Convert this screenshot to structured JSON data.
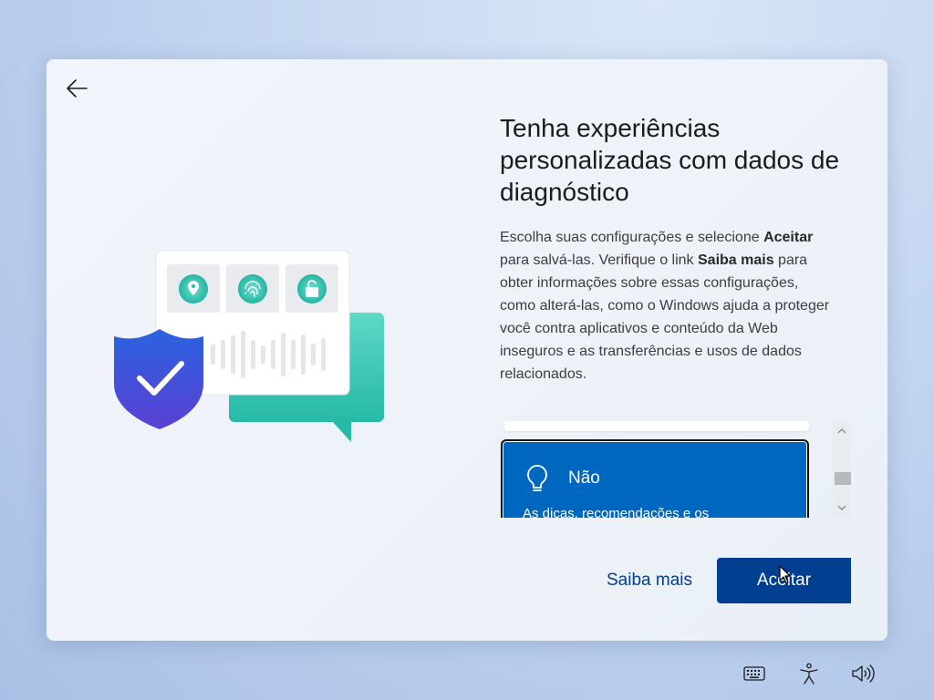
{
  "dialog": {
    "title": "Tenha experiências personalizadas com dados de diagnóstico",
    "description": {
      "part1": "Escolha suas configurações e selecione ",
      "bold1": "Aceitar",
      "part2": " para salvá-las. Verifique o link ",
      "bold2": "Saiba mais",
      "part3": " para obter informações sobre essas configurações, como alterá-las, como o Windows ajuda a proteger você contra aplicativos e conteúdo da Web inseguros e as transferências e usos de dados relacionados."
    },
    "option": {
      "title": "Não",
      "subtitle": "As dicas, recomendações e os"
    },
    "learn_more_label": "Saiba mais",
    "accept_label": "Aceitar"
  },
  "icons": {
    "back": "arrow-left-icon",
    "option": "lightbulb-icon",
    "taskbar": [
      "keyboard-icon",
      "accessibility-icon",
      "speaker-icon"
    ]
  },
  "colors": {
    "accent": "#0067c0",
    "button": "#003e92",
    "teal": "#2fc3b1",
    "shield": "#3b5bdb"
  }
}
